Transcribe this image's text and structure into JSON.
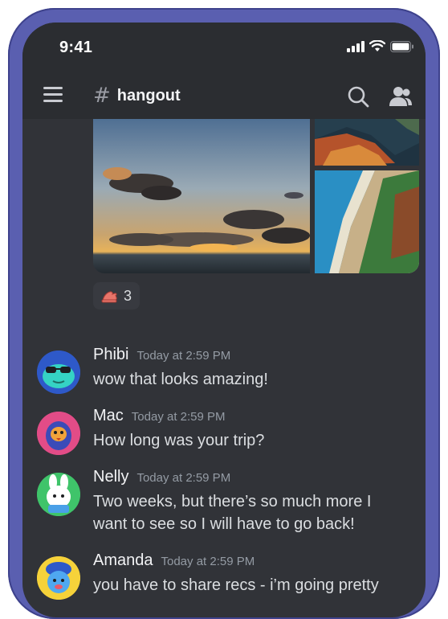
{
  "status": {
    "time": "9:41"
  },
  "header": {
    "channel_hash": "#",
    "channel_name": "hangout"
  },
  "reaction": {
    "count": "3"
  },
  "messages": [
    {
      "author": "Phibi",
      "timestamp": "Today at 2:59 PM",
      "text": "wow that looks amazing!"
    },
    {
      "author": "Mac",
      "timestamp": "Today at 2:59 PM",
      "text": "How long was your trip?"
    },
    {
      "author": "Nelly",
      "timestamp": "Today at 2:59 PM",
      "text": "Two weeks, but there’s so much more I want to see so I will have to go back!"
    },
    {
      "author": "Amanda",
      "timestamp": "Today at 2:59 PM",
      "text": "you have to share recs - i’m going pretty"
    }
  ],
  "colors": {
    "frame": "#5a5fb0",
    "background": "#313338",
    "header_bg": "#2b2d31",
    "text_primary": "#f2f3f5",
    "text_muted": "#949ba4"
  },
  "icons": [
    "hamburger-menu-icon",
    "hash-icon",
    "search-icon",
    "members-icon",
    "signal-icon",
    "wifi-icon",
    "battery-icon",
    "hand-emoji-icon"
  ]
}
